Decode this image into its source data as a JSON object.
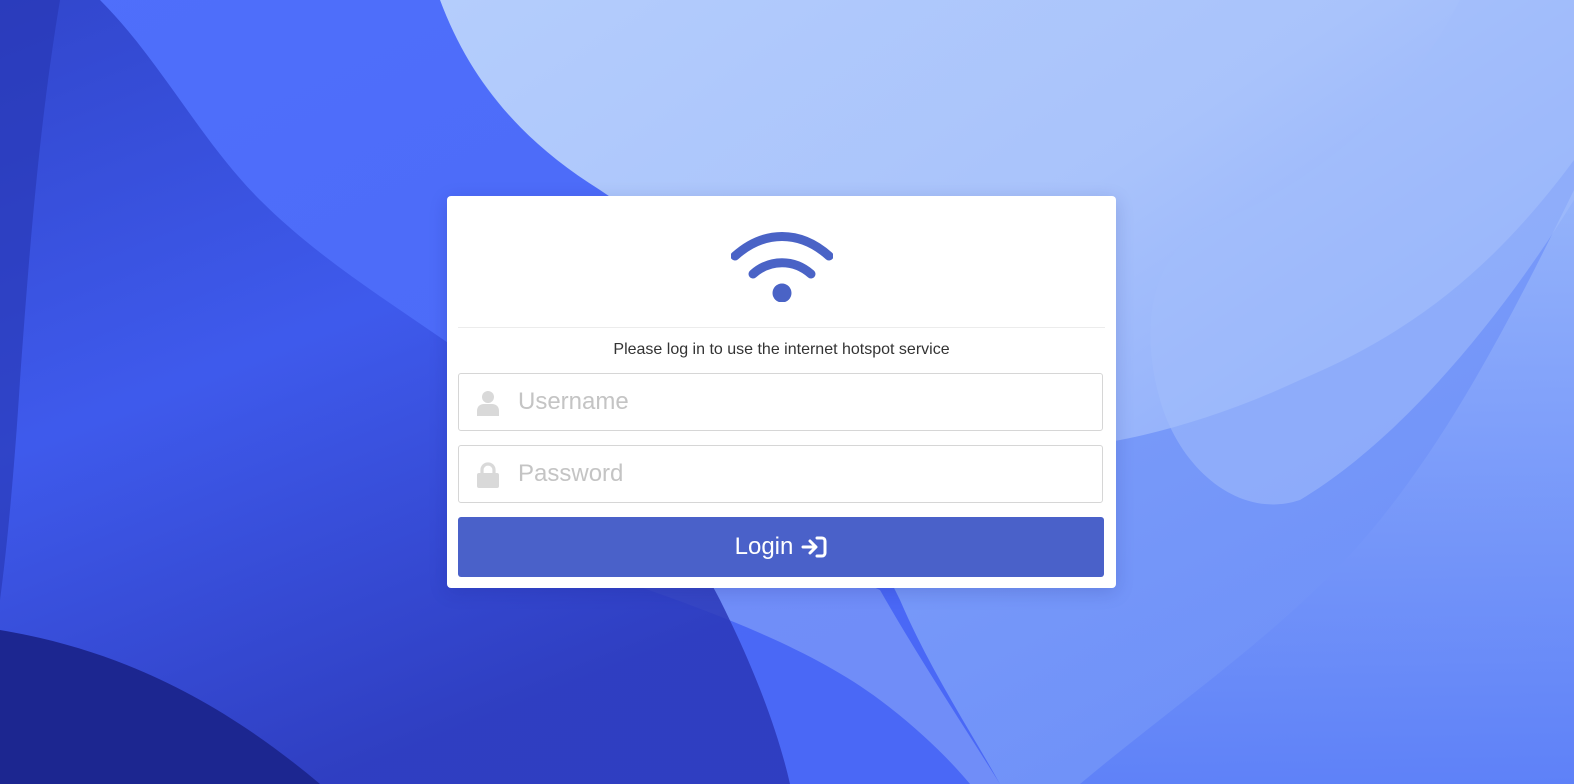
{
  "colors": {
    "accent": "#4a61c9",
    "icon_blue": "#4a63c6",
    "field_icon": "#d9d9d9",
    "placeholder": "#c4c4c4"
  },
  "logo": {
    "icon": "wifi-icon"
  },
  "login_form": {
    "subtitle": "Please log in to use the internet hotspot service",
    "username": {
      "placeholder": "Username",
      "value": "",
      "icon": "user-icon"
    },
    "password": {
      "placeholder": "Password",
      "value": "",
      "icon": "lock-icon"
    },
    "submit": {
      "label": "Login",
      "icon": "sign-in-icon"
    }
  }
}
